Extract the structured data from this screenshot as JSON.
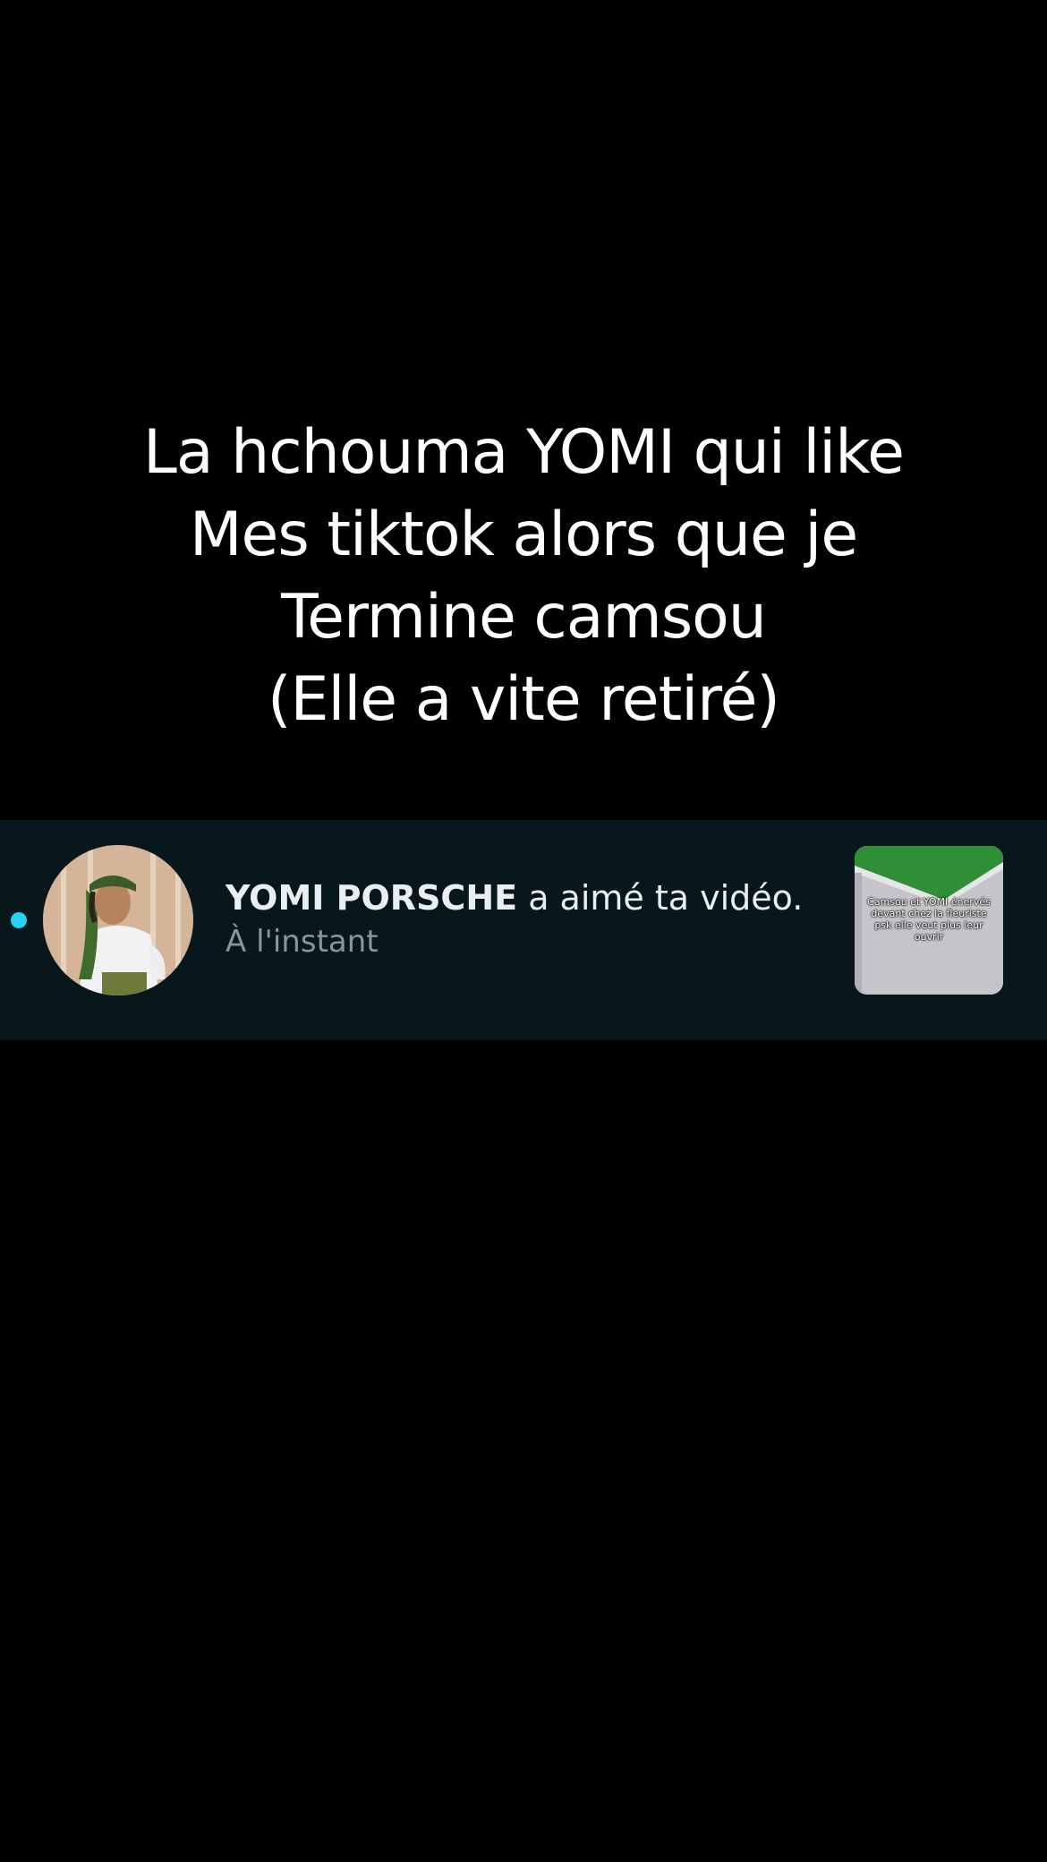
{
  "caption": {
    "lines": [
      "La hchouma YOMI qui like",
      "Mes tiktok alors que je",
      "Termine camsou",
      "(Elle a vite retiré)"
    ]
  },
  "notification": {
    "username": "YOMI PORSCHE",
    "action": "a aimé ta vidéo.",
    "time": "À l'instant",
    "unread": true,
    "thumbnail_caption": "Camsou et YOMI énervés devant chez la fleuriste psk elle veut plus leur ouvrir",
    "colors": {
      "background": "#07171c",
      "unread_dot": "#25d4f4",
      "username": "#e9eef0",
      "time": "#8a9599"
    }
  },
  "icons": {
    "avatar": "profile-photo",
    "thumbnail": "video-thumbnail"
  }
}
